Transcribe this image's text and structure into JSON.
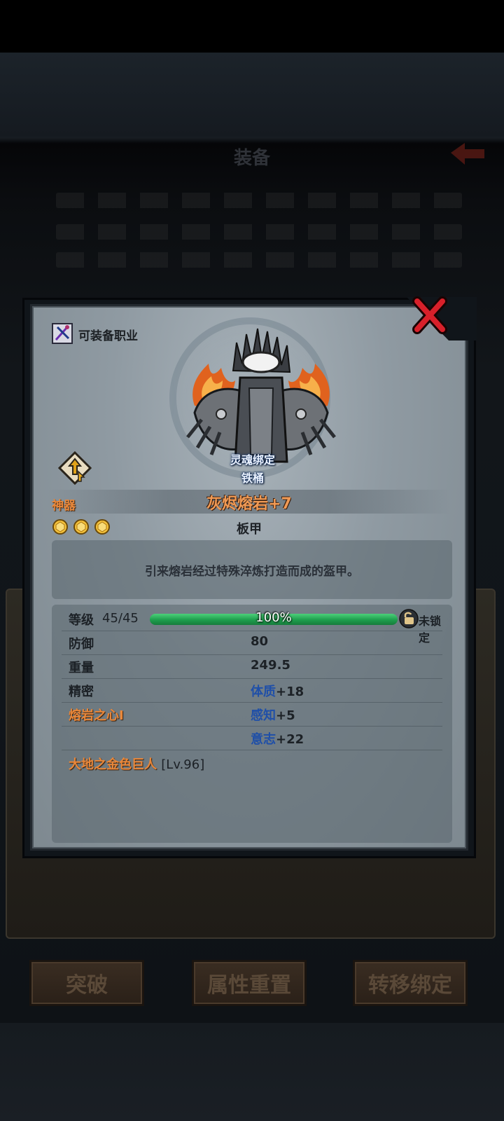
{
  "background": {
    "title": "装备",
    "buttons": [
      "突破",
      "属性重置",
      "转移绑定"
    ]
  },
  "modal": {
    "class_label": "可装备职业",
    "bind_status": "灵魂绑定",
    "owner": "铁桶",
    "grade": "神器",
    "item_name": "灰烬熔岩+7",
    "item_type": "板甲",
    "stars": 3,
    "description": "引来熔岩经过特殊淬炼打造而成的盔甲。",
    "level": {
      "label": "等级",
      "value": "45/45",
      "progress": 1.0,
      "progress_text": "100%",
      "lock_status": "未锁定"
    },
    "stats": [
      {
        "key": "防御",
        "value": "80"
      },
      {
        "key": "重量",
        "value": "249.5"
      },
      {
        "key": "精密",
        "attr": "体质",
        "bonus": "+18"
      },
      {
        "key": "熔岩之心I",
        "attr": "感知",
        "bonus": "+5"
      },
      {
        "key": "",
        "attr": "意志",
        "bonus": "+22"
      }
    ],
    "set_bonus": {
      "name": "大地之金色巨人",
      "level": "[Lv.96]"
    }
  },
  "colors": {
    "accent_orange": "#e8873a",
    "attr_blue": "#1f4fa8",
    "xp_green": "#1e9e4d",
    "close_red": "#d8202a"
  }
}
